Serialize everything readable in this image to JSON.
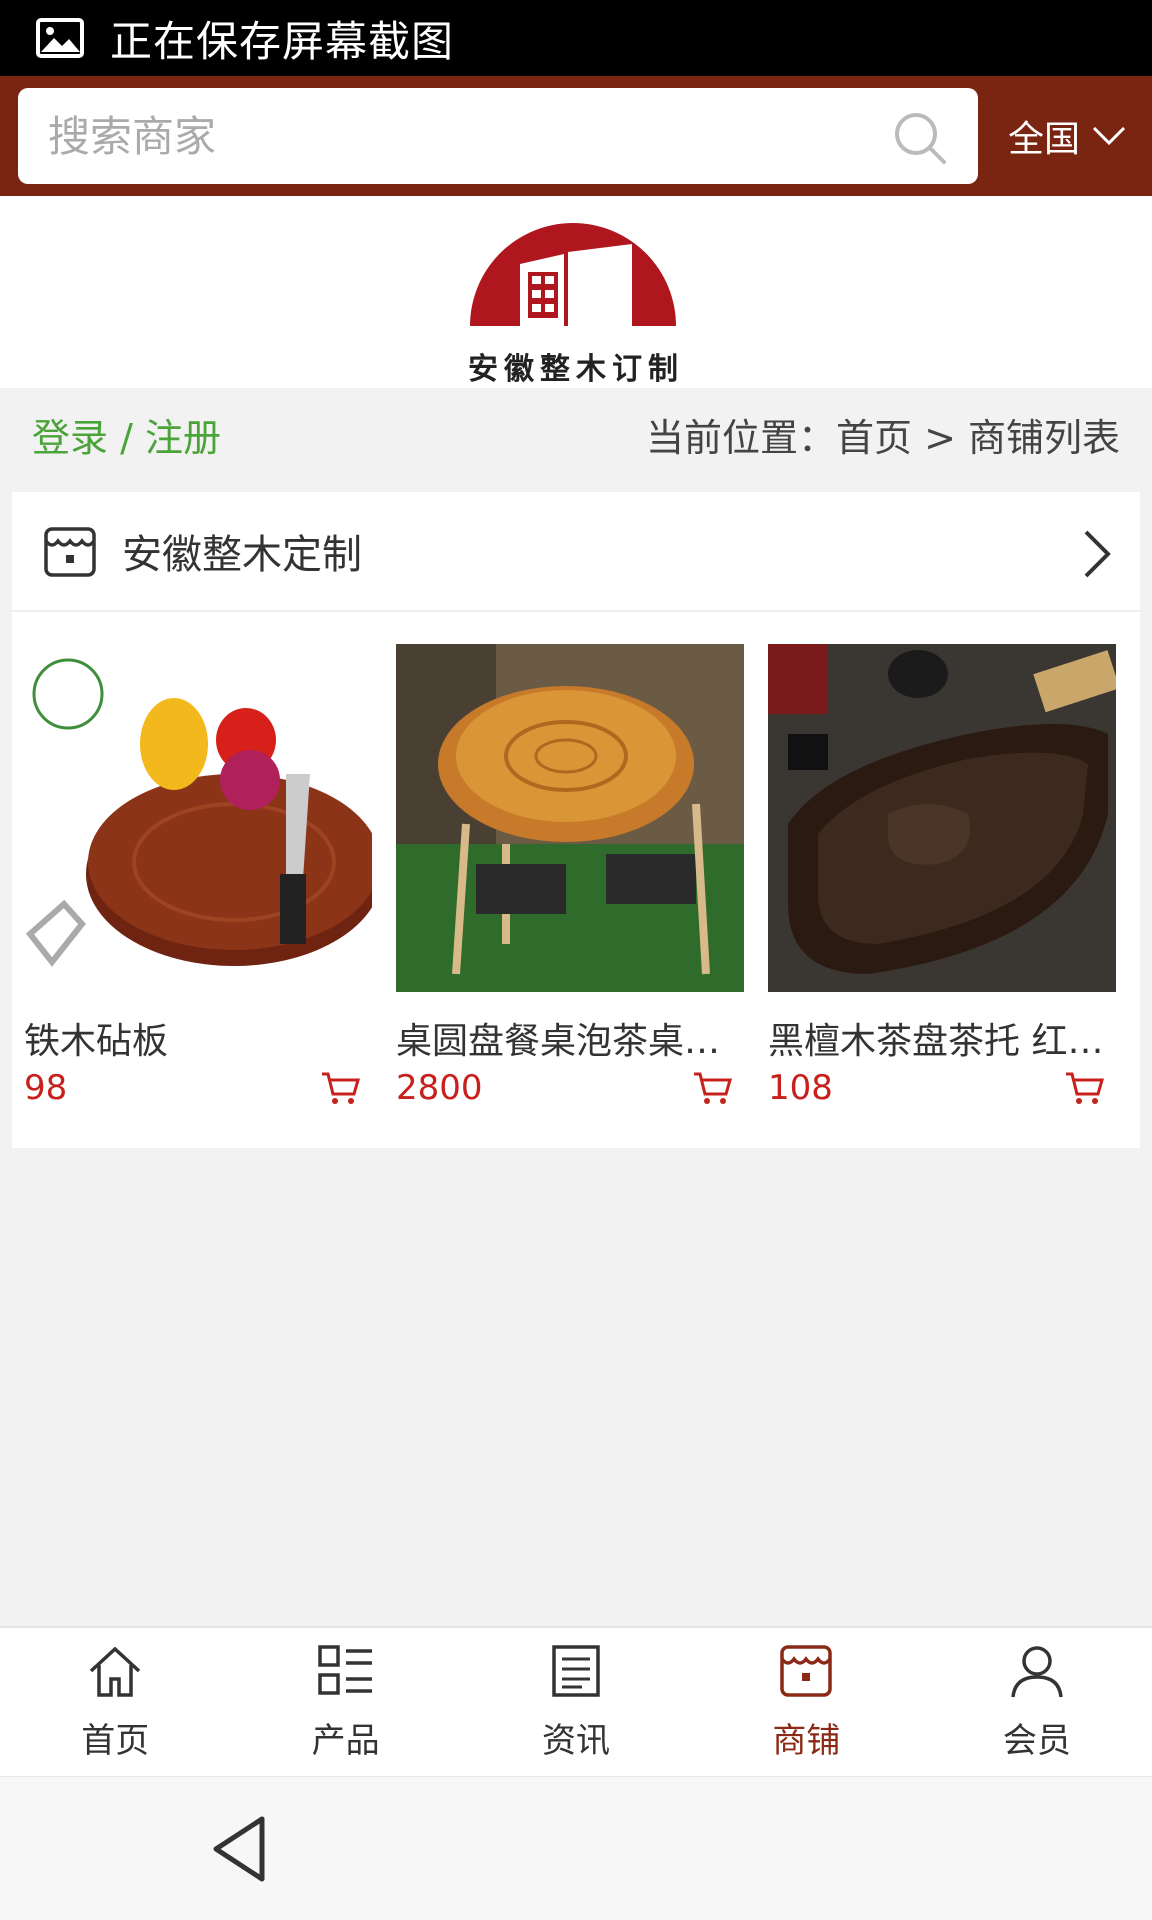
{
  "status_bar": {
    "text": "正在保存屏幕截图",
    "icon": "image-icon"
  },
  "search": {
    "placeholder": "搜索商家",
    "region_label": "全国"
  },
  "logo": {
    "text": "安徽整木订制"
  },
  "breadcrumb": {
    "login_link": "登录 / 注册",
    "location": "当前位置：首页 > 商铺列表"
  },
  "shop": {
    "name": "安徽整木定制",
    "products": [
      {
        "name": "铁木砧板",
        "price": "98"
      },
      {
        "name": "桌圆盘餐桌泡茶桌…",
        "price": "2800"
      },
      {
        "name": "黑檀木茶盘茶托 红…",
        "price": "108"
      }
    ]
  },
  "bottom_nav": {
    "items": [
      {
        "label": "首页",
        "icon": "home-icon"
      },
      {
        "label": "产品",
        "icon": "grid-list-icon"
      },
      {
        "label": "资讯",
        "icon": "news-icon"
      },
      {
        "label": "商铺",
        "icon": "store-icon",
        "active": true
      },
      {
        "label": "会员",
        "icon": "user-icon"
      }
    ]
  },
  "colors": {
    "header": "#7a2412",
    "login_green": "#4aa43a",
    "price_red": "#c8201c",
    "active_nav": "#8a2a16"
  }
}
